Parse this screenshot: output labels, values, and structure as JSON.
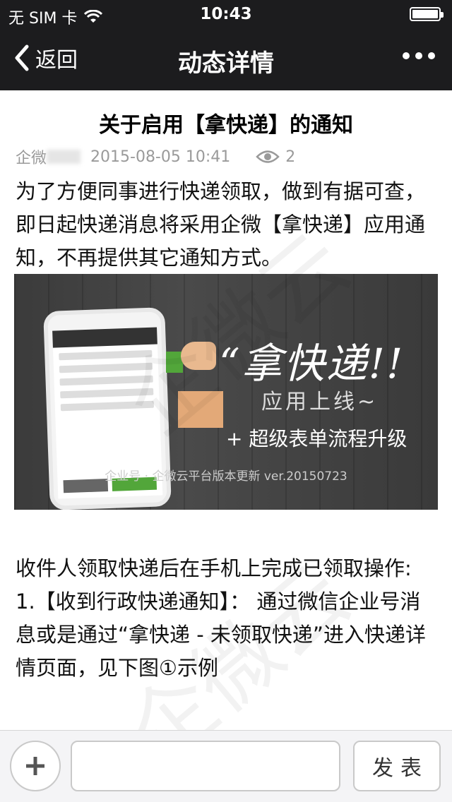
{
  "status_bar": {
    "carrier": "无 SIM 卡",
    "time": "10:43"
  },
  "nav": {
    "back_label": "返回",
    "title": "动态详情"
  },
  "article": {
    "title": "关于启用【拿快递】的通知",
    "author": "企微",
    "date": "2015-08-05 10:41",
    "views": "2",
    "paragraph1": "为了方便同事进行快递领取，做到有据可查，即日起快递消息将采用企微【拿快递】应用通知，不再提供其它通知方式。",
    "banner": {
      "headline": "“拿快递!!",
      "subline": "应用上线~",
      "line2": "+ 超级表单流程升级",
      "footer": "企业号 · 企微云平台版本更新 ver.20150723"
    },
    "paragraph2_l1": "收件人领取快递后在手机上完成已领取操作:",
    "paragraph2_l2": "1.【收到行政快递通知】： 通过微信企业号消息或是通过“拿快递 - 未领取快递”进入快递详情页面，见下图①示例"
  },
  "bottom": {
    "send_label": "发表",
    "input_placeholder": ""
  },
  "colors": {
    "bar_bg": "#1c1c1e",
    "banner_green": "#52a63a"
  }
}
